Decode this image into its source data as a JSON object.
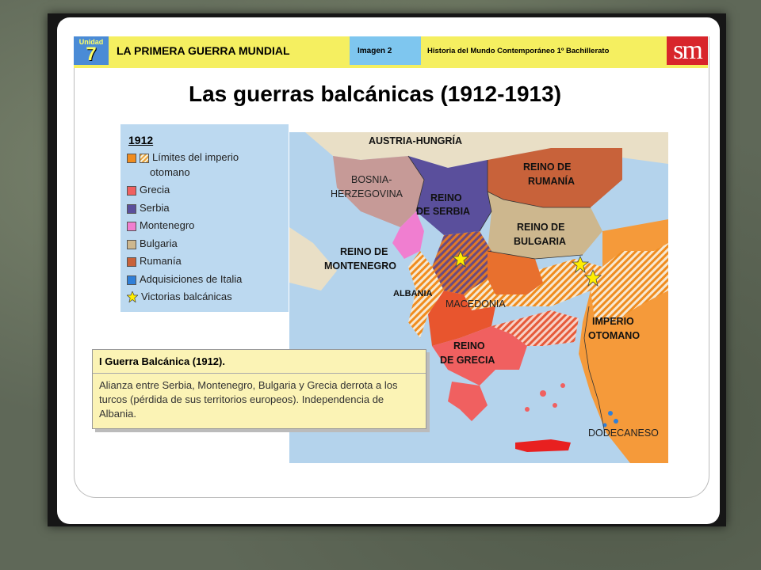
{
  "header": {
    "unit_label": "Unidad",
    "unit_number": "7",
    "title": "LA PRIMERA GUERRA MUNDIAL",
    "image_label": "Imagen 2",
    "course": "Historia del Mundo Contemporáneo 1º Bachillerato",
    "logo": "sm"
  },
  "page_title": "Las guerras balcánicas (1912-1913)",
  "legend": {
    "year": "1912",
    "items": [
      {
        "label": "Límites del imperio",
        "label2": "otomano",
        "color": "#f08c1e",
        "hatch": true
      },
      {
        "label": "Grecia",
        "color": "#f06060"
      },
      {
        "label": "Serbia",
        "color": "#5a4f9c"
      },
      {
        "label": "Montenegro",
        "color": "#f07ed0"
      },
      {
        "label": "Bulgaria",
        "color": "#cdb78e"
      },
      {
        "label": "Rumanía",
        "color": "#c8623a"
      },
      {
        "label": "Adquisiciones de Italia",
        "color": "#2f7fd8"
      },
      {
        "label": "Victorias balcánicas",
        "icon": "victory-star-icon"
      }
    ]
  },
  "map": {
    "labels": {
      "austria": "AUSTRIA-HUNGRÍA",
      "bosnia1": "BOSNIA-",
      "bosnia2": "HERZEGOVINA",
      "serbia1": "REINO",
      "serbia2": "DE SERBIA",
      "rumania1": "REINO DE",
      "rumania2": "RUMANÍA",
      "bulgaria1": "REINO DE",
      "bulgaria2": "BULGARIA",
      "montenegro1": "REINO DE",
      "montenegro2": "MONTENEGRO",
      "albania": "ALBANIA",
      "macedonia": "MACEDONIA",
      "otomano1": "IMPERIO",
      "otomano2": "OTOMANO",
      "grecia1": "REINO",
      "grecia2": "DE GRECIA",
      "dodecaneso": "DODECANESO"
    },
    "colors": {
      "sea": "#b4d3ec",
      "austria": "#e9dfc6",
      "bosnia": "#c69a97",
      "serbia": "#5a4f9c",
      "montenegro": "#f07ed0",
      "bulgaria": "#cdb78e",
      "rumania": "#c8623a",
      "ottoman": "#f59a3a",
      "greece": "#f06060",
      "italy": "#2f7fd8",
      "victory": "#ffee00"
    }
  },
  "info": {
    "title": "I Guerra Balcánica (1912).",
    "body": "Alianza entre Serbia, Montenegro, Bulgaria y Grecia derrota a los turcos (pérdida de sus territorios europeos). Independencia de Albania."
  }
}
